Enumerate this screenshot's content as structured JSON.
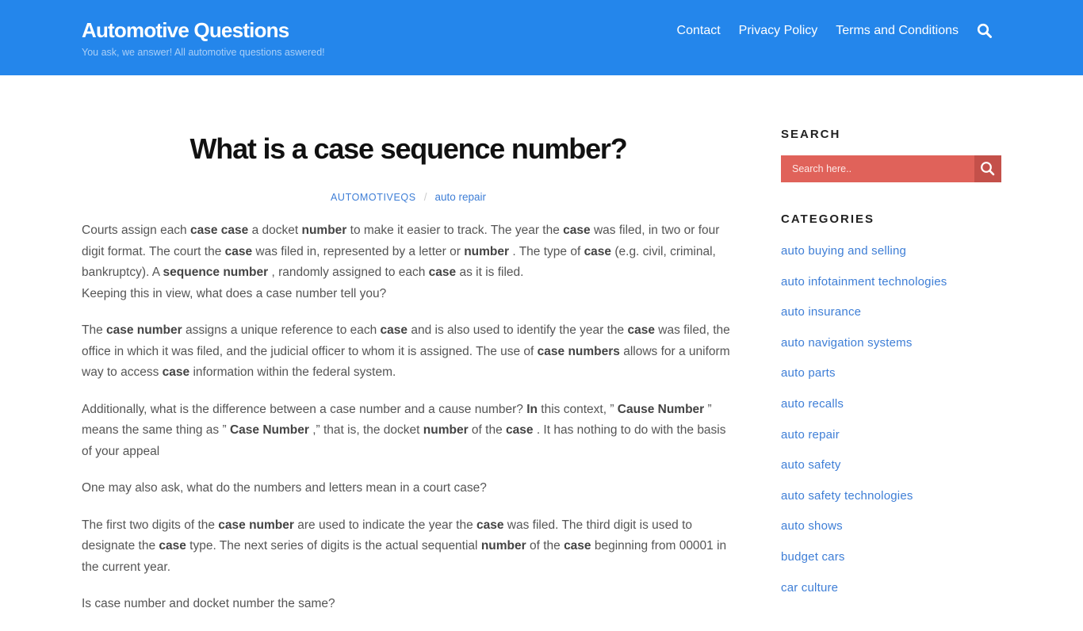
{
  "header": {
    "site_title": "Automotive Questions",
    "tagline": "You ask, we answer! All automotive questions aswered!",
    "nav": [
      {
        "label": "Contact"
      },
      {
        "label": "Privacy Policy"
      },
      {
        "label": "Terms and Conditions"
      }
    ],
    "search_icon": "search-icon",
    "background_color": "#2486eb"
  },
  "article": {
    "title": "What is a case sequence number?",
    "meta": {
      "author": "AUTOMOTIVEQS",
      "separator": "/",
      "category": "auto repair"
    },
    "paragraphs": [
      {
        "segments": [
          {
            "t": "Courts assign each "
          },
          {
            "b": "case case"
          },
          {
            "t": " a docket "
          },
          {
            "b": "number"
          },
          {
            "t": " to make it easier to track. The year the "
          },
          {
            "b": "case"
          },
          {
            "t": " was filed, in two or four digit format. The court the "
          },
          {
            "b": "case"
          },
          {
            "t": " was filed in, represented by a letter or "
          },
          {
            "b": "number"
          },
          {
            "t": " . The type of "
          },
          {
            "b": "case"
          },
          {
            "t": " (e.g. civil, criminal, bankruptcy). A "
          },
          {
            "b": "sequence number"
          },
          {
            "t": " , randomly assigned to each "
          },
          {
            "b": "case"
          },
          {
            "t": " as it is filed."
          }
        ],
        "tight": true
      },
      {
        "segments": [
          {
            "t": "Keeping this in view, what does a case number tell you?"
          }
        ]
      },
      {
        "segments": [
          {
            "t": "The "
          },
          {
            "b": "case number"
          },
          {
            "t": " assigns a unique reference to each "
          },
          {
            "b": "case"
          },
          {
            "t": " and is also used to identify the year the "
          },
          {
            "b": "case"
          },
          {
            "t": " was filed, the office in which it was filed, and the judicial officer to whom it is assigned. The use of "
          },
          {
            "b": "case numbers"
          },
          {
            "t": " allows for a uniform way to access "
          },
          {
            "b": "case"
          },
          {
            "t": " information within the federal system."
          }
        ]
      },
      {
        "segments": [
          {
            "t": "Additionally, what is the difference between a case number and a cause number? "
          },
          {
            "b": "In"
          },
          {
            "t": " this context, ” "
          },
          {
            "b": "Cause Number"
          },
          {
            "t": " ” means the same thing as ” "
          },
          {
            "b": "Case Number"
          },
          {
            "t": " ,” that is, the docket "
          },
          {
            "b": "number"
          },
          {
            "t": " of the "
          },
          {
            "b": "case"
          },
          {
            "t": " . It has nothing to do with the basis of your appeal"
          }
        ]
      },
      {
        "segments": [
          {
            "t": "One may also ask, what do the numbers and letters mean in a court case?"
          }
        ]
      },
      {
        "segments": [
          {
            "t": "The first two digits of the "
          },
          {
            "b": "case number"
          },
          {
            "t": " are used to indicate the year the "
          },
          {
            "b": "case"
          },
          {
            "t": " was filed. The third digit is used to designate the "
          },
          {
            "b": "case"
          },
          {
            "t": " type. The next series of digits is the actual sequential "
          },
          {
            "b": "number"
          },
          {
            "t": " of the "
          },
          {
            "b": "case"
          },
          {
            "t": " beginning from 00001 in the current year."
          }
        ]
      },
      {
        "segments": [
          {
            "t": "Is case number and docket number the same?"
          }
        ]
      }
    ]
  },
  "sidebar": {
    "search": {
      "title": "SEARCH",
      "placeholder": "Search here..",
      "value": "",
      "input_color": "#e0625a",
      "button_color": "#c4504a"
    },
    "categories": {
      "title": "CATEGORIES",
      "items": [
        {
          "label": "auto buying and selling"
        },
        {
          "label": "auto infotainment technologies"
        },
        {
          "label": "auto insurance"
        },
        {
          "label": "auto navigation systems"
        },
        {
          "label": "auto parts"
        },
        {
          "label": "auto recalls"
        },
        {
          "label": "auto repair"
        },
        {
          "label": "auto safety"
        },
        {
          "label": "auto safety technologies"
        },
        {
          "label": "auto shows"
        },
        {
          "label": "budget cars"
        },
        {
          "label": "car culture"
        }
      ]
    },
    "link_color": "#3e7ed6"
  }
}
